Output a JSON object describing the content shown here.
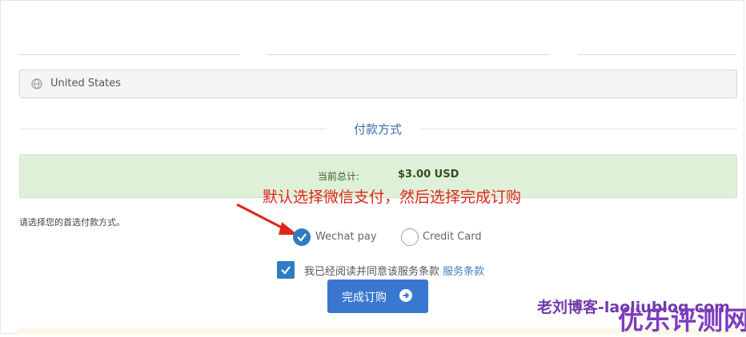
{
  "address": {
    "country": "United States"
  },
  "payment": {
    "section_title": "付款方式",
    "total_label": "当前总计:",
    "total_amount": "$3.00 USD",
    "prompt": "请选择您的首选付款方式。",
    "options": [
      {
        "label": "Wechat pay",
        "selected": true
      },
      {
        "label": "Credit Card",
        "selected": false
      }
    ]
  },
  "annotation": {
    "text": "默认选择微信支付，然后选择完成订购",
    "color": "#e0251b"
  },
  "tos": {
    "text": "我已经阅读并同意该服务条款",
    "link": "服务条款",
    "checked": true
  },
  "submit": {
    "label": "完成订购",
    "icon": "arrow-circle-right-icon"
  },
  "watermarks": {
    "line1": "老刘博客-laoliublog.com",
    "line2": "优乐评测网"
  },
  "colors": {
    "accent": "#3a78d0",
    "success_bg": "#dff0d8"
  }
}
